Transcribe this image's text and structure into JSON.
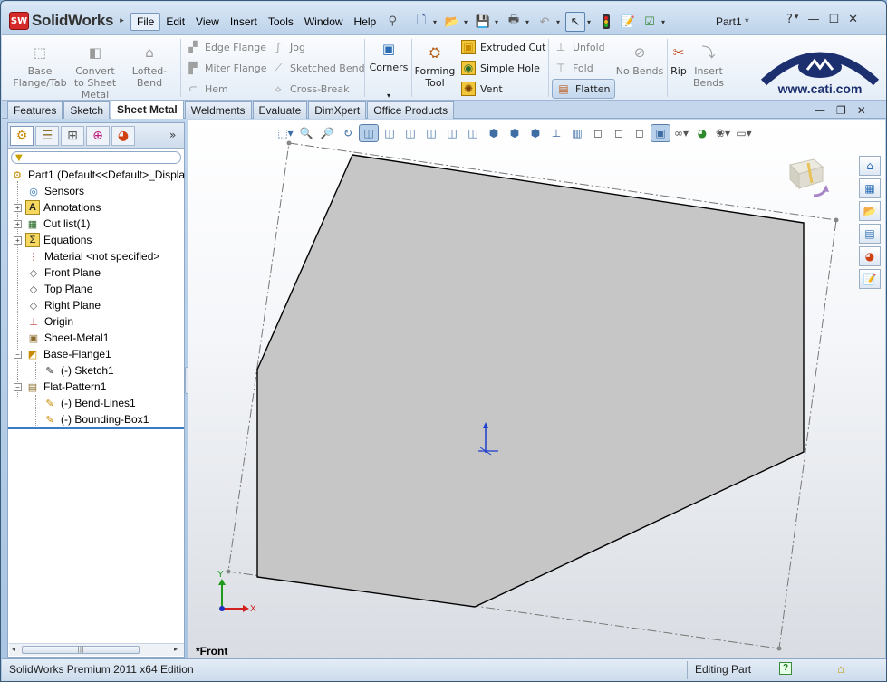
{
  "app": {
    "logo_badge": "SW",
    "logo_text": "SolidWorks",
    "document_title": "Part1 *"
  },
  "menu": [
    "File",
    "Edit",
    "View",
    "Insert",
    "Tools",
    "Window",
    "Help"
  ],
  "ribbon": {
    "base_flange": "Base Flange/Tab",
    "convert": "Convert to Sheet Metal",
    "lofted_bend": "Lofted-Bend",
    "edge_flange": "Edge Flange",
    "miter_flange": "Miter Flange",
    "hem": "Hem",
    "jog": "Jog",
    "sketched_bend": "Sketched Bend",
    "cross_break": "Cross-Break",
    "corners": "Corners",
    "forming_tool": "Forming Tool",
    "extruded_cut": "Extruded Cut",
    "simple_hole": "Simple Hole",
    "vent": "Vent",
    "unfold": "Unfold",
    "fold": "Fold",
    "flatten": "Flatten",
    "no_bends": "No Bends",
    "rip": "Rip",
    "insert_bends": "Insert Bends"
  },
  "brand": {
    "url_text": "www.cati.com",
    "color": "#1c2f6e"
  },
  "tabs": [
    "Features",
    "Sketch",
    "Sheet Metal",
    "Weldments",
    "Evaluate",
    "DimXpert",
    "Office Products"
  ],
  "active_tab": "Sheet Metal",
  "tree": {
    "root": "Part1  (Default<<Default>_Displa",
    "items": [
      {
        "label": "Sensors"
      },
      {
        "label": "Annotations"
      },
      {
        "label": "Cut list(1)"
      },
      {
        "label": "Equations"
      },
      {
        "label": "Material <not specified>"
      },
      {
        "label": "Front Plane"
      },
      {
        "label": "Top Plane"
      },
      {
        "label": "Right Plane"
      },
      {
        "label": "Origin"
      },
      {
        "label": "Sheet-Metal1"
      },
      {
        "label": "Base-Flange1"
      },
      {
        "label": "(-) Sketch1"
      },
      {
        "label": "Flat-Pattern1"
      },
      {
        "label": "(-) Bend-Lines1"
      },
      {
        "label": "(-) Bounding-Box1"
      }
    ]
  },
  "graphics": {
    "view_name": "*Front",
    "axis_x": "X",
    "axis_y": "Y",
    "part_fill": "#c6c6c6",
    "edge_color": "#000000"
  },
  "status": {
    "left": "SolidWorks Premium 2011 x64 Edition",
    "mode": "Editing Part",
    "help": "?"
  },
  "colors": {
    "accent": "#2a6db5",
    "active_tab_bg": "#ffffff",
    "tree_underline": "#3b7cc2"
  }
}
